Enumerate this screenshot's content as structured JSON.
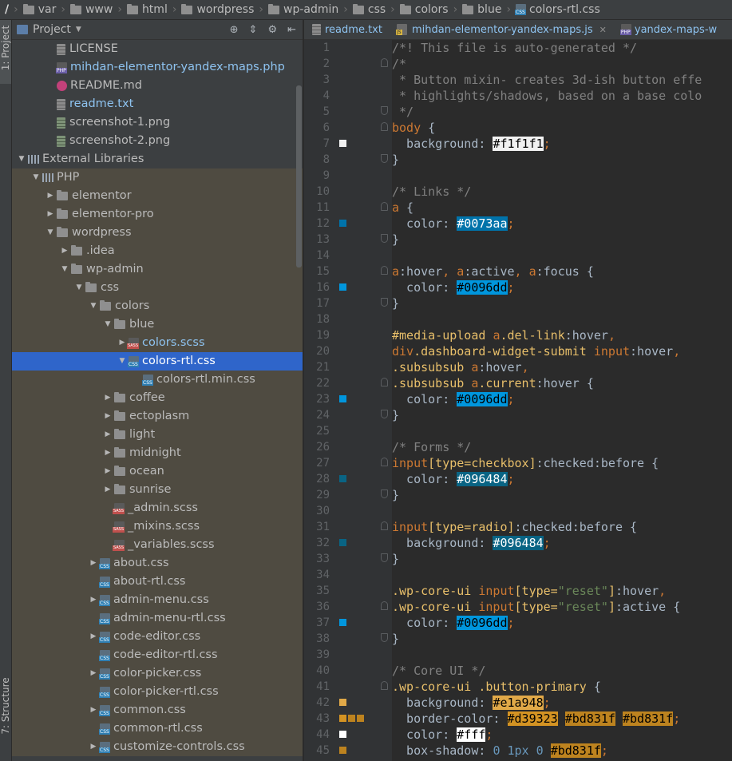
{
  "breadcrumb": [
    {
      "label": "/",
      "icon": "root-folder-icon"
    },
    {
      "label": "var",
      "icon": "folder-icon"
    },
    {
      "label": "www",
      "icon": "folder-icon"
    },
    {
      "label": "html",
      "icon": "folder-icon"
    },
    {
      "label": "wordpress",
      "icon": "folder-icon"
    },
    {
      "label": "wp-admin",
      "icon": "folder-icon"
    },
    {
      "label": "css",
      "icon": "folder-icon"
    },
    {
      "label": "colors",
      "icon": "folder-icon"
    },
    {
      "label": "blue",
      "icon": "folder-icon"
    },
    {
      "label": "colors-rtl.css",
      "icon": "css-file-icon"
    }
  ],
  "side_tabs": {
    "project": "1: Project",
    "structure": "7: Structure"
  },
  "project_panel": {
    "title": "Project",
    "icons": [
      "locate-icon",
      "collapse-icon",
      "settings-icon",
      "hide-icon"
    ]
  },
  "tree": [
    {
      "label": "LICENSE",
      "indent": 2,
      "icon": "txt",
      "arrow": "",
      "style": "",
      "bg": ""
    },
    {
      "label": "mihdan-elementor-yandex-maps.php",
      "indent": 2,
      "icon": "php",
      "arrow": "",
      "style": "c-php",
      "bg": ""
    },
    {
      "label": "README.md",
      "indent": 2,
      "icon": "md",
      "arrow": "",
      "style": "",
      "bg": ""
    },
    {
      "label": "readme.txt",
      "indent": 2,
      "icon": "txt",
      "arrow": "",
      "style": "c-txt",
      "bg": ""
    },
    {
      "label": "screenshot-1.png",
      "indent": 2,
      "icon": "img",
      "arrow": "",
      "style": "",
      "bg": ""
    },
    {
      "label": "screenshot-2.png",
      "indent": 2,
      "icon": "img",
      "arrow": "",
      "style": "",
      "bg": ""
    },
    {
      "label": "External Libraries",
      "indent": 0,
      "icon": "lib",
      "arrow": "down",
      "style": "",
      "bg": ""
    },
    {
      "label": "PHP",
      "indent": 1,
      "icon": "lib",
      "arrow": "down",
      "style": "",
      "bg": "lib"
    },
    {
      "label": "elementor",
      "indent": 2,
      "icon": "folder",
      "arrow": "right",
      "style": "",
      "bg": "lib"
    },
    {
      "label": "elementor-pro",
      "indent": 2,
      "icon": "folder",
      "arrow": "right",
      "style": "",
      "bg": "lib"
    },
    {
      "label": "wordpress",
      "indent": 2,
      "icon": "folder",
      "arrow": "down",
      "style": "",
      "bg": "lib"
    },
    {
      "label": ".idea",
      "indent": 3,
      "icon": "folder",
      "arrow": "right",
      "style": "",
      "bg": "lib"
    },
    {
      "label": "wp-admin",
      "indent": 3,
      "icon": "folder",
      "arrow": "down",
      "style": "",
      "bg": "lib"
    },
    {
      "label": "css",
      "indent": 4,
      "icon": "folder",
      "arrow": "down",
      "style": "",
      "bg": "lib"
    },
    {
      "label": "colors",
      "indent": 5,
      "icon": "folder",
      "arrow": "down",
      "style": "",
      "bg": "lib"
    },
    {
      "label": "blue",
      "indent": 6,
      "icon": "folder",
      "arrow": "down",
      "style": "",
      "bg": "lib"
    },
    {
      "label": "colors.scss",
      "indent": 7,
      "icon": "sass",
      "arrow": "right",
      "style": "c-php",
      "bg": "lib"
    },
    {
      "label": "colors-rtl.css",
      "indent": 7,
      "icon": "css",
      "arrow": "down",
      "style": "c-php",
      "bg": "sel"
    },
    {
      "label": "colors-rtl.min.css",
      "indent": 8,
      "icon": "css",
      "arrow": "",
      "style": "",
      "bg": "lib"
    },
    {
      "label": "coffee",
      "indent": 6,
      "icon": "folder",
      "arrow": "right",
      "style": "",
      "bg": "lib"
    },
    {
      "label": "ectoplasm",
      "indent": 6,
      "icon": "folder",
      "arrow": "right",
      "style": "",
      "bg": "lib"
    },
    {
      "label": "light",
      "indent": 6,
      "icon": "folder",
      "arrow": "right",
      "style": "",
      "bg": "lib"
    },
    {
      "label": "midnight",
      "indent": 6,
      "icon": "folder",
      "arrow": "right",
      "style": "",
      "bg": "lib"
    },
    {
      "label": "ocean",
      "indent": 6,
      "icon": "folder",
      "arrow": "right",
      "style": "",
      "bg": "lib"
    },
    {
      "label": "sunrise",
      "indent": 6,
      "icon": "folder",
      "arrow": "right",
      "style": "",
      "bg": "lib"
    },
    {
      "label": "_admin.scss",
      "indent": 6,
      "icon": "sass",
      "arrow": "",
      "style": "",
      "bg": "lib"
    },
    {
      "label": "_mixins.scss",
      "indent": 6,
      "icon": "sass",
      "arrow": "",
      "style": "",
      "bg": "lib"
    },
    {
      "label": "_variables.scss",
      "indent": 6,
      "icon": "sass",
      "arrow": "",
      "style": "",
      "bg": "lib"
    },
    {
      "label": "about.css",
      "indent": 5,
      "icon": "css",
      "arrow": "right",
      "style": "",
      "bg": "lib"
    },
    {
      "label": "about-rtl.css",
      "indent": 5,
      "icon": "css",
      "arrow": "",
      "style": "",
      "bg": "lib"
    },
    {
      "label": "admin-menu.css",
      "indent": 5,
      "icon": "css",
      "arrow": "right",
      "style": "",
      "bg": "lib"
    },
    {
      "label": "admin-menu-rtl.css",
      "indent": 5,
      "icon": "css",
      "arrow": "",
      "style": "",
      "bg": "lib"
    },
    {
      "label": "code-editor.css",
      "indent": 5,
      "icon": "css",
      "arrow": "right",
      "style": "",
      "bg": "lib"
    },
    {
      "label": "code-editor-rtl.css",
      "indent": 5,
      "icon": "css",
      "arrow": "",
      "style": "",
      "bg": "lib"
    },
    {
      "label": "color-picker.css",
      "indent": 5,
      "icon": "css",
      "arrow": "right",
      "style": "",
      "bg": "lib"
    },
    {
      "label": "color-picker-rtl.css",
      "indent": 5,
      "icon": "css",
      "arrow": "",
      "style": "",
      "bg": "lib"
    },
    {
      "label": "common.css",
      "indent": 5,
      "icon": "css",
      "arrow": "right",
      "style": "",
      "bg": "lib"
    },
    {
      "label": "common-rtl.css",
      "indent": 5,
      "icon": "css",
      "arrow": "",
      "style": "",
      "bg": "lib"
    },
    {
      "label": "customize-controls.css",
      "indent": 5,
      "icon": "css",
      "arrow": "right",
      "style": "",
      "bg": "lib"
    }
  ],
  "editor_tabs": [
    {
      "label": "readme.txt",
      "icon": "txt-file-icon",
      "active": false,
      "close": false
    },
    {
      "label": "mihdan-elementor-yandex-maps.js",
      "icon": "js-file-icon",
      "active": false,
      "close": true
    },
    {
      "label": "yandex-maps-w",
      "icon": "php-file-icon",
      "active": false,
      "close": false
    }
  ],
  "colors": {
    "accent": "#2f65ca",
    "panel": "#3c3f41",
    "editor": "#2b2b2b",
    "library_bg": "#4f4b41"
  },
  "code": [
    {
      "n": "1",
      "sw": [],
      "fold": "",
      "t": [
        [
          "/*! This file is auto-generated */",
          "t-com"
        ]
      ]
    },
    {
      "n": "2",
      "sw": [],
      "fold": "start",
      "t": [
        [
          "/*",
          "t-com"
        ]
      ]
    },
    {
      "n": "3",
      "sw": [],
      "fold": "",
      "t": [
        [
          " * Button mixin- creates 3d-ish button effe",
          "t-com"
        ]
      ]
    },
    {
      "n": "4",
      "sw": [],
      "fold": "",
      "t": [
        [
          " * highlights/shadows, based on a base colo",
          "t-com"
        ]
      ]
    },
    {
      "n": "5",
      "sw": [],
      "fold": "end",
      "t": [
        [
          " */",
          "t-com"
        ]
      ]
    },
    {
      "n": "6",
      "sw": [],
      "fold": "start",
      "t": [
        [
          "body",
          "t-tag"
        ],
        [
          " {",
          ""
        ]
      ]
    },
    {
      "n": "7",
      "sw": [
        "#f1f1f1"
      ],
      "fold": "",
      "t": [
        [
          "  background: ",
          ""
        ],
        [
          "#f1f1f1",
          "hl-l",
          "#f1f1f1"
        ],
        [
          ";",
          "t-kw"
        ]
      ]
    },
    {
      "n": "8",
      "sw": [],
      "fold": "end",
      "t": [
        [
          "}",
          ""
        ]
      ]
    },
    {
      "n": "9",
      "sw": [],
      "fold": "",
      "t": []
    },
    {
      "n": "10",
      "sw": [],
      "fold": "",
      "t": [
        [
          "/* Links */",
          "t-com"
        ]
      ]
    },
    {
      "n": "11",
      "sw": [],
      "fold": "start",
      "t": [
        [
          "a",
          "t-tag"
        ],
        [
          " {",
          ""
        ]
      ]
    },
    {
      "n": "12",
      "sw": [
        "#0073aa"
      ],
      "fold": "",
      "t": [
        [
          "  color: ",
          ""
        ],
        [
          "#0073aa",
          "hl-d",
          "#0073aa"
        ],
        [
          ";",
          "t-kw"
        ]
      ]
    },
    {
      "n": "13",
      "sw": [],
      "fold": "end",
      "t": [
        [
          "}",
          ""
        ]
      ]
    },
    {
      "n": "14",
      "sw": [],
      "fold": "",
      "t": []
    },
    {
      "n": "15",
      "sw": [],
      "fold": "start",
      "t": [
        [
          "a",
          "t-tag"
        ],
        [
          ":hover",
          ""
        ],
        [
          ", ",
          "t-kw"
        ],
        [
          "a",
          "t-tag"
        ],
        [
          ":active",
          ""
        ],
        [
          ", ",
          "t-kw"
        ],
        [
          "a",
          "t-tag"
        ],
        [
          ":focus",
          ""
        ],
        [
          " {",
          ""
        ]
      ]
    },
    {
      "n": "16",
      "sw": [
        "#0096dd"
      ],
      "fold": "",
      "t": [
        [
          "  color: ",
          ""
        ],
        [
          "#0096dd",
          "hl-l",
          "#0096dd"
        ],
        [
          ";",
          "t-kw"
        ]
      ]
    },
    {
      "n": "17",
      "sw": [],
      "fold": "end",
      "t": [
        [
          "}",
          ""
        ]
      ]
    },
    {
      "n": "18",
      "sw": [],
      "fold": "",
      "t": []
    },
    {
      "n": "19",
      "sw": [],
      "fold": "",
      "t": [
        [
          "#media-upload ",
          "t-sel"
        ],
        [
          "a",
          "t-tag"
        ],
        [
          ".del-link",
          "t-sel"
        ],
        [
          ":hover",
          ""
        ],
        [
          ",",
          "t-kw"
        ]
      ]
    },
    {
      "n": "20",
      "sw": [],
      "fold": "",
      "t": [
        [
          "div",
          "t-tag"
        ],
        [
          ".dashboard-widget-submit ",
          "t-sel"
        ],
        [
          "input",
          "t-tag"
        ],
        [
          ":hover",
          ""
        ],
        [
          ",",
          "t-kw"
        ]
      ]
    },
    {
      "n": "21",
      "sw": [],
      "fold": "",
      "t": [
        [
          ".subsubsub ",
          "t-sel"
        ],
        [
          "a",
          "t-tag"
        ],
        [
          ":hover",
          ""
        ],
        [
          ",",
          "t-kw"
        ]
      ]
    },
    {
      "n": "22",
      "sw": [],
      "fold": "start",
      "t": [
        [
          ".subsubsub ",
          "t-sel"
        ],
        [
          "a",
          "t-tag"
        ],
        [
          ".current",
          "t-sel"
        ],
        [
          ":hover",
          ""
        ],
        [
          " {",
          ""
        ]
      ]
    },
    {
      "n": "23",
      "sw": [
        "#0096dd"
      ],
      "fold": "",
      "t": [
        [
          "  color: ",
          ""
        ],
        [
          "#0096dd",
          "hl-l",
          "#0096dd"
        ],
        [
          ";",
          "t-kw"
        ]
      ]
    },
    {
      "n": "24",
      "sw": [],
      "fold": "end",
      "t": [
        [
          "}",
          ""
        ]
      ]
    },
    {
      "n": "25",
      "sw": [],
      "fold": "",
      "t": []
    },
    {
      "n": "26",
      "sw": [],
      "fold": "",
      "t": [
        [
          "/* Forms */",
          "t-com"
        ]
      ]
    },
    {
      "n": "27",
      "sw": [],
      "fold": "start",
      "t": [
        [
          "input",
          "t-tag"
        ],
        [
          "[type=checkbox]",
          "t-sel"
        ],
        [
          ":checked",
          ""
        ],
        [
          ":before",
          ""
        ],
        [
          " {",
          ""
        ]
      ]
    },
    {
      "n": "28",
      "sw": [
        "#096484"
      ],
      "fold": "",
      "t": [
        [
          "  color: ",
          ""
        ],
        [
          "#096484",
          "hl-d",
          "#096484"
        ],
        [
          ";",
          "t-kw"
        ]
      ]
    },
    {
      "n": "29",
      "sw": [],
      "fold": "end",
      "t": [
        [
          "}",
          ""
        ]
      ]
    },
    {
      "n": "30",
      "sw": [],
      "fold": "",
      "t": []
    },
    {
      "n": "31",
      "sw": [],
      "fold": "start",
      "t": [
        [
          "input",
          "t-tag"
        ],
        [
          "[type=radio]",
          "t-sel"
        ],
        [
          ":checked",
          ""
        ],
        [
          ":before",
          ""
        ],
        [
          " {",
          ""
        ]
      ]
    },
    {
      "n": "32",
      "sw": [
        "#096484"
      ],
      "fold": "",
      "t": [
        [
          "  background: ",
          ""
        ],
        [
          "#096484",
          "hl-d",
          "#096484"
        ],
        [
          ";",
          "t-kw"
        ]
      ]
    },
    {
      "n": "33",
      "sw": [],
      "fold": "end",
      "t": [
        [
          "}",
          ""
        ]
      ]
    },
    {
      "n": "34",
      "sw": [],
      "fold": "",
      "t": []
    },
    {
      "n": "35",
      "sw": [],
      "fold": "",
      "t": [
        [
          ".wp-core-ui ",
          "t-sel"
        ],
        [
          "input",
          "t-tag"
        ],
        [
          "[type=",
          "t-sel"
        ],
        [
          "\"reset\"",
          "t-str"
        ],
        [
          "]",
          "t-sel"
        ],
        [
          ":hover",
          ""
        ],
        [
          ",",
          "t-kw"
        ]
      ]
    },
    {
      "n": "36",
      "sw": [],
      "fold": "start",
      "t": [
        [
          ".wp-core-ui ",
          "t-sel"
        ],
        [
          "input",
          "t-tag"
        ],
        [
          "[type=",
          "t-sel"
        ],
        [
          "\"reset\"",
          "t-str"
        ],
        [
          "]",
          "t-sel"
        ],
        [
          ":active",
          ""
        ],
        [
          " {",
          ""
        ]
      ]
    },
    {
      "n": "37",
      "sw": [
        "#0096dd"
      ],
      "fold": "",
      "t": [
        [
          "  color: ",
          ""
        ],
        [
          "#0096dd",
          "hl-l",
          "#0096dd"
        ],
        [
          ";",
          "t-kw"
        ]
      ]
    },
    {
      "n": "38",
      "sw": [],
      "fold": "end",
      "t": [
        [
          "}",
          ""
        ]
      ]
    },
    {
      "n": "39",
      "sw": [],
      "fold": "",
      "t": []
    },
    {
      "n": "40",
      "sw": [],
      "fold": "",
      "t": [
        [
          "/* Core UI */",
          "t-com"
        ]
      ]
    },
    {
      "n": "41",
      "sw": [],
      "fold": "start",
      "t": [
        [
          ".wp-core-ui ",
          "t-sel"
        ],
        [
          ".button-primary",
          "t-sel"
        ],
        [
          " {",
          ""
        ]
      ]
    },
    {
      "n": "42",
      "sw": [
        "#e1a948"
      ],
      "fold": "",
      "t": [
        [
          "  background: ",
          ""
        ],
        [
          "#e1a948",
          "hl-l",
          "#e1a948"
        ],
        [
          ";",
          "t-kw"
        ]
      ]
    },
    {
      "n": "43",
      "sw": [
        "#d39323",
        "#bd831f",
        "#bd831f"
      ],
      "fold": "",
      "t": [
        [
          "  border-color: ",
          ""
        ],
        [
          "#d39323",
          "hl-l",
          "#d39323"
        ],
        [
          " ",
          ""
        ],
        [
          "#bd831f",
          "hl-l",
          "#bd831f"
        ],
        [
          " ",
          ""
        ],
        [
          "#bd831f",
          "hl-l",
          "#bd831f"
        ],
        [
          ";",
          "t-kw"
        ]
      ]
    },
    {
      "n": "44",
      "sw": [
        "#ffffff"
      ],
      "fold": "",
      "t": [
        [
          "  color: ",
          ""
        ],
        [
          "#fff",
          "hl-l",
          "#ffffff"
        ],
        [
          ";",
          "t-kw"
        ]
      ]
    },
    {
      "n": "45",
      "sw": [
        "#bd831f"
      ],
      "fold": "",
      "t": [
        [
          "  box-shadow: ",
          ""
        ],
        [
          "0 ",
          "t-num"
        ],
        [
          "1px ",
          "t-num"
        ],
        [
          "0 ",
          "t-num"
        ],
        [
          "#bd831f",
          "hl-l",
          "#bd831f"
        ],
        [
          ";",
          "t-kw"
        ]
      ]
    }
  ]
}
